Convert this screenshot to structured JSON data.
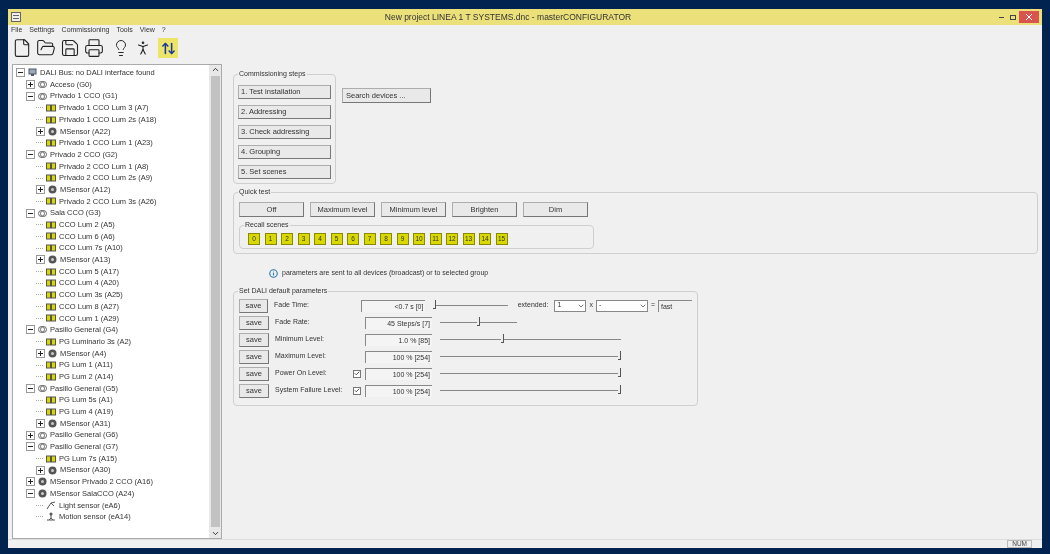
{
  "window": {
    "title": "New project LINEA 1 T SYSTEMS.dnc - masterCONFIGURATOR"
  },
  "menu": [
    "File",
    "Settings",
    "Commissioning",
    "Tools",
    "View",
    "?"
  ],
  "tree": [
    {
      "kind": "bus",
      "label": "DALI Bus: no DALI interface found",
      "expanded": true,
      "children": [
        {
          "kind": "group",
          "label": "Acceso (G0)",
          "expanded": false
        },
        {
          "kind": "group",
          "label": "Privado 1 CCO (G1)",
          "expanded": true,
          "children": [
            {
              "kind": "lum",
              "label": "Privado 1 CCO Lum 3 (A7)"
            },
            {
              "kind": "lum",
              "label": "Privado 1 CCO Lum 2s (A18)"
            },
            {
              "kind": "sensor",
              "label": "MSensor (A22)",
              "expanded": false
            },
            {
              "kind": "lum",
              "label": "Privado 1 CCO Lum 1 (A23)"
            }
          ]
        },
        {
          "kind": "group",
          "label": "Privado 2 CCO (G2)",
          "expanded": true,
          "children": [
            {
              "kind": "lum",
              "label": "Privado 2 CCO Lum 1 (A8)"
            },
            {
              "kind": "lum",
              "label": "Privado 2 CCO Lum 2s (A9)"
            },
            {
              "kind": "sensor",
              "label": "MSensor (A12)",
              "expanded": false
            },
            {
              "kind": "lum",
              "label": "Privado 2 CCO Lum 3s (A26)"
            }
          ]
        },
        {
          "kind": "group",
          "label": "Sala CCO  (G3)",
          "expanded": true,
          "children": [
            {
              "kind": "lum",
              "label": "CCO Lum 2 (A5)"
            },
            {
              "kind": "lum",
              "label": "CCO Lum 6 (A6)"
            },
            {
              "kind": "lum",
              "label": "CCO Lum 7s (A10)"
            },
            {
              "kind": "sensor",
              "label": "MSensor (A13)",
              "expanded": false
            },
            {
              "kind": "lum",
              "label": "CCO Lum 5 (A17)"
            },
            {
              "kind": "lum",
              "label": "CCO Lum 4 (A20)"
            },
            {
              "kind": "lum",
              "label": "CCO Lum 3s (A25)"
            },
            {
              "kind": "lum",
              "label": "CCO Lum 8 (A27)"
            },
            {
              "kind": "lum",
              "label": "CCO Lum 1 (A29)"
            }
          ]
        },
        {
          "kind": "group",
          "label": "Pasillo General (G4)",
          "expanded": true,
          "children": [
            {
              "kind": "lum",
              "label": "PG Luminario 3s (A2)"
            },
            {
              "kind": "sensor",
              "label": "MSensor (A4)",
              "expanded": false
            },
            {
              "kind": "lum",
              "label": "PG Lum 1 (A11)"
            },
            {
              "kind": "lum",
              "label": "PG Lum 2 (A14)"
            }
          ]
        },
        {
          "kind": "group",
          "label": "Pasillo General (G5)",
          "expanded": true,
          "children": [
            {
              "kind": "lum",
              "label": "PG Lum 5s (A1)"
            },
            {
              "kind": "lum",
              "label": "PG Lum 4 (A19)"
            },
            {
              "kind": "sensor",
              "label": "MSensor (A31)",
              "expanded": false
            }
          ]
        },
        {
          "kind": "group",
          "label": "Pasillo General  (G6)",
          "expanded": false
        },
        {
          "kind": "group",
          "label": "Pasillo General  (G7)",
          "expanded": true,
          "children": [
            {
              "kind": "lum",
              "label": "PG Lum 7s (A15)"
            },
            {
              "kind": "sensor",
              "label": "MSensor (A30)",
              "expanded": false
            }
          ]
        },
        {
          "kind": "sensor",
          "label": "MSensor Privado 2  CCO (A16)",
          "expanded": false
        },
        {
          "kind": "sensor",
          "label": "MSensor SalaCCO (A24)",
          "expanded": true,
          "children": [
            {
              "kind": "light",
              "label": "Light sensor (eA6)"
            },
            {
              "kind": "motion",
              "label": "Motion sensor (eA14)"
            }
          ]
        }
      ]
    }
  ],
  "commissioning": {
    "title": "Commissioning steps",
    "steps": [
      "1. Test installation",
      "2. Addressing",
      "3. Check addressing",
      "4. Grouping",
      "5. Set scenes"
    ],
    "search_button": "Search devices ..."
  },
  "quick_test": {
    "title": "Quick test",
    "buttons": [
      "Off",
      "Maximum level",
      "Minimum level",
      "Brighten",
      "Dim"
    ],
    "scenes_title": "Recall scenes",
    "scenes": [
      "0",
      "1",
      "2",
      "3",
      "4",
      "5",
      "6",
      "7",
      "8",
      "9",
      "10",
      "11",
      "12",
      "13",
      "14",
      "15"
    ]
  },
  "info": "parameters are sent to all devices (broadcast) or to selected group",
  "defaults": {
    "title": "Set DALI default parameters",
    "rows": [
      {
        "save": "save",
        "label": "Fade Time:",
        "value": "<0.7  s [0]",
        "level": 0,
        "short": true
      },
      {
        "save": "save",
        "label": "Fade Rate:",
        "value": "45  Steps/s [7]",
        "level": 0.5,
        "short": true
      },
      {
        "save": "save",
        "label": "Minimum Level:",
        "value": "1.0 % [85]",
        "level": 0.34,
        "short": false
      },
      {
        "save": "save",
        "label": "Maximum Level:",
        "value": "100 % [254]",
        "level": 1,
        "short": false
      },
      {
        "save": "save",
        "label": "Power On Level:",
        "value": "100 % [254]",
        "level": 1,
        "short": false,
        "checked": true
      },
      {
        "save": "save",
        "label": "System Failure Level:",
        "value": "100 % [254]",
        "level": 1,
        "short": false,
        "checked": true
      }
    ],
    "extended": {
      "label": "extended:",
      "factor": "1",
      "times": "x",
      "unit": "-",
      "equals": "=",
      "result": "fast"
    }
  },
  "status_bar": {
    "indicator": "NUM"
  }
}
